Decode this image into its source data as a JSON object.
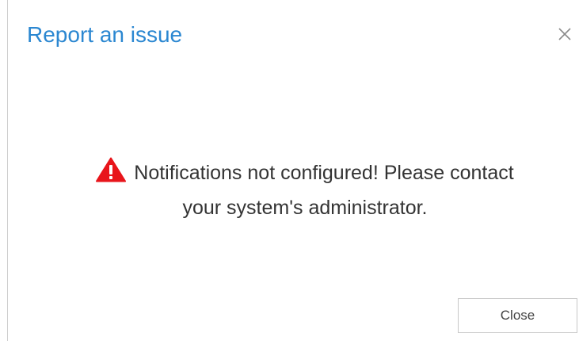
{
  "dialog": {
    "title": "Report an issue",
    "close_icon": "close-x-icon",
    "message_line1": "Notifications not configured! Please contact",
    "message_line2": "your system's administrator.",
    "warning_icon": "warning-triangle-icon",
    "close_button_label": "Close"
  },
  "colors": {
    "title": "#2b87d1",
    "warning": "#e8151b",
    "text": "#333333"
  }
}
